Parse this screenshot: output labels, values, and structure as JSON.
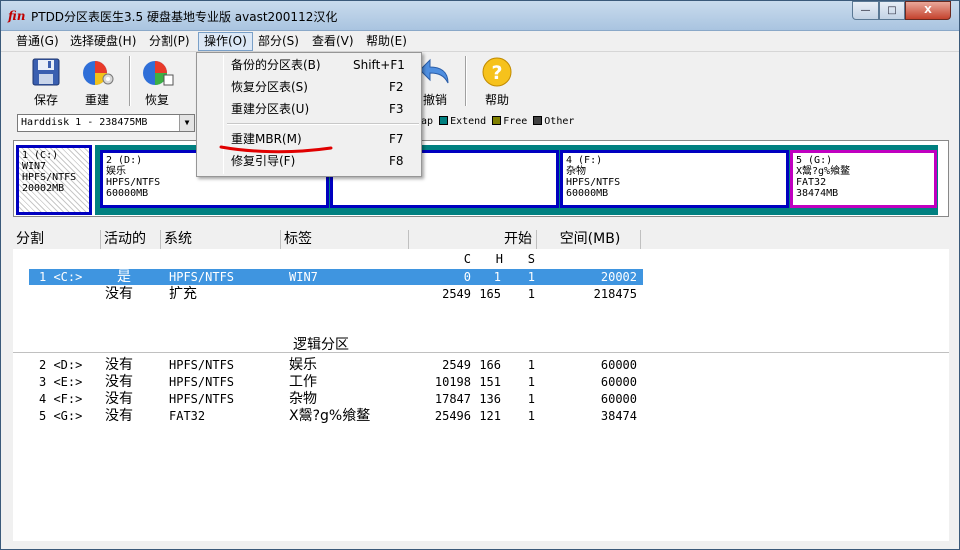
{
  "window": {
    "title": "PTDD分区表医生3.5 硬盘基地专业版 avast200112汉化",
    "app_icon_glyph": "ﬁn",
    "controls": {
      "minimize": "—",
      "maximize": "□",
      "close": "X"
    }
  },
  "menubar": {
    "items": [
      "普通(G)",
      "选择硬盘(H)",
      "分割(P)",
      "操作(O)",
      "部分(S)",
      "查看(V)",
      "帮助(E)"
    ]
  },
  "toolbar": {
    "buttons": [
      {
        "label": "保存",
        "icon": "floppy-disk-icon"
      },
      {
        "label": "重建",
        "icon": "rebuild-pie-icon"
      },
      {
        "label": "恢复",
        "icon": "recover-pie-icon"
      },
      {
        "label": "撤销",
        "icon": "undo-arrow-icon"
      },
      {
        "label": "帮助",
        "icon": "help-question-icon"
      }
    ]
  },
  "disk_selector": {
    "value": "Harddisk 1 - 238475MB"
  },
  "legend": {
    "items": [
      {
        "label": "wap",
        "color": "#f0f0f0"
      },
      {
        "label": "Extend",
        "color": "#008080"
      },
      {
        "label": "Free",
        "color": "#808000"
      },
      {
        "label": "Other",
        "color": "#404040"
      }
    ]
  },
  "operations_menu": {
    "items": [
      {
        "label": "备份的分区表(B)",
        "shortcut": "Shift+F1"
      },
      {
        "label": "恢复分区表(S)",
        "shortcut": "F2"
      },
      {
        "label": "重建分区表(U)",
        "shortcut": "F3"
      },
      {
        "label": "重建MBR(M)",
        "shortcut": "F7"
      },
      {
        "label": "修复引导(F)",
        "shortcut": "F8"
      }
    ],
    "highlight_color": "#e00000"
  },
  "disk_map": {
    "partitions": [
      {
        "line1": "1 (C:)",
        "line2": "WIN7",
        "line3": "HPFS/NTFS",
        "line4": "20002MB",
        "border": "#0000c0"
      },
      {
        "line1": "2 (D:)",
        "line2": "娱乐",
        "line3": "HPFS/NTFS",
        "line4": "60000MB",
        "border": "#0000c0"
      },
      {
        "line1": "",
        "line2": "",
        "line3": "HPFS/NTFS",
        "line4": "60000MB",
        "border": "#0000c0"
      },
      {
        "line1": "4 (F:)",
        "line2": "杂物",
        "line3": "HPFS/NTFS",
        "line4": "60000MB",
        "border": "#0000c0"
      },
      {
        "line1": "5 (G:)",
        "line2": "X鬶?g%飨鳌",
        "line3": "FAT32",
        "line4": "38474MB",
        "border": "#c000c0"
      }
    ],
    "extend_color": "#008080"
  },
  "table": {
    "headers": [
      "分割",
      "活动的",
      "系统",
      "标签",
      "开始",
      "空间(MB)"
    ],
    "subheaders": [
      "C",
      "H",
      "S"
    ],
    "primary_rows": [
      {
        "part": "1 <C:>",
        "active": "是",
        "system": "HPFS/NTFS",
        "label": "WIN7",
        "c": "0",
        "h": "1",
        "s": "1",
        "size": "20002"
      },
      {
        "part": "",
        "active": "没有",
        "system": "扩充",
        "label": "",
        "c": "2549",
        "h": "165",
        "s": "1",
        "size": "218475"
      }
    ],
    "section_title": "逻辑分区",
    "logical_rows": [
      {
        "part": "2 <D:>",
        "active": "没有",
        "system": "HPFS/NTFS",
        "label": "娱乐",
        "c": "2549",
        "h": "166",
        "s": "1",
        "size": "60000"
      },
      {
        "part": "3 <E:>",
        "active": "没有",
        "system": "HPFS/NTFS",
        "label": "工作",
        "c": "10198",
        "h": "151",
        "s": "1",
        "size": "60000"
      },
      {
        "part": "4 <F:>",
        "active": "没有",
        "system": "HPFS/NTFS",
        "label": "杂物",
        "c": "17847",
        "h": "136",
        "s": "1",
        "size": "60000"
      },
      {
        "part": "5 <G:>",
        "active": "没有",
        "system": "FAT32",
        "label": "X鬶?g%飨鳌",
        "c": "25496",
        "h": "121",
        "s": "1",
        "size": "38474"
      }
    ]
  }
}
